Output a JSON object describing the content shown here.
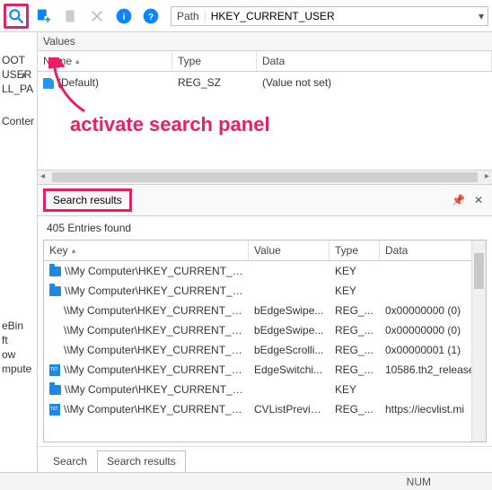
{
  "toolbar": {
    "path_label": "Path",
    "path_value": "HKEY_CURRENT_USER"
  },
  "tree": {
    "items": [
      "OOT",
      "USER",
      "LL_PA",
      "",
      "Conter",
      "",
      "",
      "",
      "",
      "eBin",
      "ft",
      "ow",
      "mpute"
    ]
  },
  "values": {
    "title": "Values",
    "columns": {
      "name": "Name",
      "type": "Type",
      "data": "Data"
    },
    "rows": [
      {
        "name": "(Default)",
        "type": "REG_SZ",
        "data": "(Value not set)"
      }
    ]
  },
  "annotation": {
    "text": "activate search panel"
  },
  "search_results": {
    "title": "Search results",
    "count": "405 Entries found",
    "columns": {
      "key": "Key",
      "value": "Value",
      "type": "Type",
      "data": "Data"
    },
    "rows": [
      {
        "icon": "folder",
        "key": "\\\\My Computer\\HKEY_CURRENT_US...",
        "value": "",
        "type": "KEY",
        "data": ""
      },
      {
        "icon": "folder",
        "key": "\\\\My Computer\\HKEY_CURRENT_US...",
        "value": "",
        "type": "KEY",
        "data": ""
      },
      {
        "icon": "",
        "key": "\\\\My Computer\\HKEY_CURRENT_US...",
        "value": "bEdgeSwipe...",
        "type": "REG_...",
        "data": "0x00000000 (0)"
      },
      {
        "icon": "",
        "key": "\\\\My Computer\\HKEY_CURRENT_US...",
        "value": "bEdgeSwipe...",
        "type": "REG_...",
        "data": "0x00000000 (0)"
      },
      {
        "icon": "",
        "key": "\\\\My Computer\\HKEY_CURRENT_US...",
        "value": "bEdgeScrolli...",
        "type": "REG_...",
        "data": "0x00000001 (1)"
      },
      {
        "icon": "txt",
        "key": "\\\\My Computer\\HKEY_CURRENT_US...",
        "value": "EdgeSwitchi...",
        "type": "REG_...",
        "data": "10586.th2_release."
      },
      {
        "icon": "folder",
        "key": "\\\\My Computer\\HKEY_CURRENT_US...",
        "value": "",
        "type": "KEY",
        "data": ""
      },
      {
        "icon": "txt",
        "key": "\\\\My Computer\\HKEY_CURRENT_US...",
        "value": "CVListPrevio...",
        "type": "REG_...",
        "data": "https://iecvlist.mi"
      }
    ]
  },
  "tabs": {
    "search": "Search",
    "results": "Search results"
  },
  "status": {
    "num": "NUM"
  }
}
